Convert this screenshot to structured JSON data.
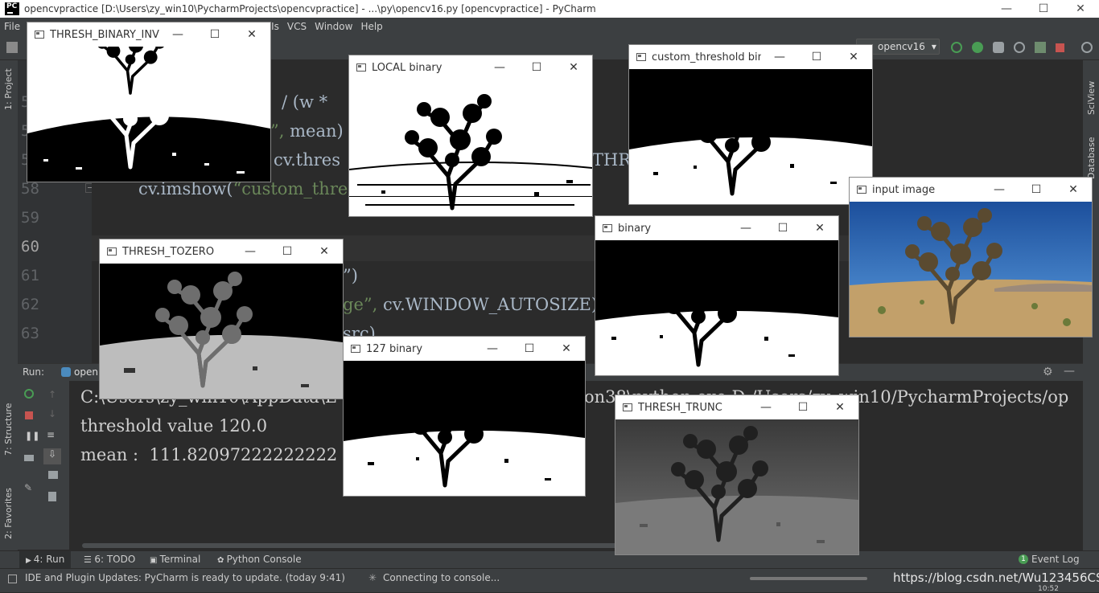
{
  "app": {
    "title": "opencvpractice [D:\\Users\\zy_win10\\PycharmProjects\\opencvpractice] - ...\\py\\opencv16.py [opencvpractice] - PyCharm",
    "logo": "PC"
  },
  "window_controls": {
    "minimize": "—",
    "maximize": "☐",
    "close": "✕"
  },
  "menu": [
    "File",
    "Is",
    "VCS",
    "Window",
    "Help"
  ],
  "toolbar": {
    "run_config": "opencv16"
  },
  "left_tools": {
    "project": "1: Project",
    "structure": "7: Structure",
    "favorites": "2: Favorites"
  },
  "right_tools": {
    "sciview": "SciView",
    "database": "Database"
  },
  "editor": {
    "line_numbers": [
      "5",
      "5",
      "5",
      "58",
      "59",
      "60",
      "61",
      "62",
      "63"
    ],
    "lines": {
      "l1": "/ (w *",
      "l2_str": "”,",
      "l2_rest": " mean)",
      "l3": "cv.thres",
      "l3_tail": "THRE",
      "l4_prefix": "cv.imshow(",
      "l4_str": "“custom_thre",
      "l6": "”)",
      "l7_str": "ge”,",
      "l7_rest": " cv.WINDOW_AUTOSIZE)",
      "l8": "src)"
    }
  },
  "run_panel": {
    "label": "Run:",
    "tab": "open",
    "console_lines": [
      "C:\\Users\\zy_win10\\AppData\\L",
      "on38\\python.exe D:/Users/zy_win10/PycharmProjects/op",
      "threshold value 120.0",
      "mean :  111.82097222222222"
    ]
  },
  "bottom_tabs": {
    "run": "4: Run",
    "todo": "6: TODO",
    "terminal": "Terminal",
    "python_console": "Python Console",
    "event_log": "Event Log",
    "event_count": "1"
  },
  "status": {
    "update": "IDE and Plugin Updates: PyCharm is ready to update. (today 9:41)",
    "console": "Connecting to console...",
    "watermark": "https://blog.csdn.net/Wu123456CS",
    "clock": "10:52"
  },
  "windows": {
    "thresh_binary_inv": "THRESH_BINARY_INV",
    "local_binary": "LOCAL binary",
    "custom_threshold": "custom_threshold bin...",
    "input_image": "input image",
    "binary": "binary",
    "thresh_tozero": "THRESH_TOZERO",
    "binary_127": "127 binary",
    "thresh_trunc": "THRESH_TRUNC"
  },
  "colors": {
    "ide_bg": "#2b2b2b",
    "panel": "#3c3f41",
    "run_green": "#499c54",
    "stop_red": "#c75450",
    "sky_blue": "#2a6fb8",
    "sand": "#c2a06a"
  }
}
